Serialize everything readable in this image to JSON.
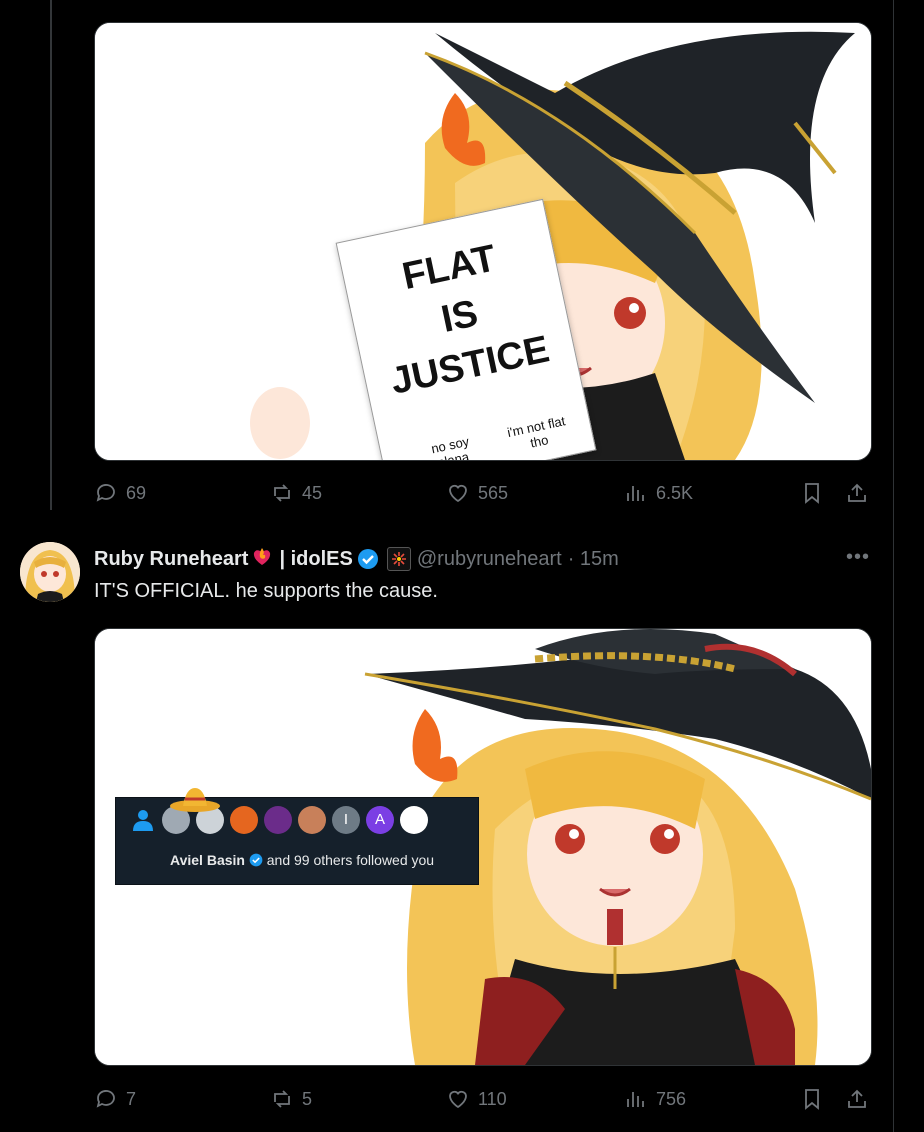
{
  "post1": {
    "sign": {
      "line1": "FLAT",
      "line2": "IS",
      "line3": "JUSTICE",
      "note_left": "no soy plana",
      "note_right": "i'm not flat tho"
    },
    "stats": {
      "replies": "69",
      "reposts": "45",
      "likes": "565",
      "views": "6.5K"
    }
  },
  "post2": {
    "author": {
      "name": "Ruby Runeheart",
      "suffix": "| idolES",
      "handle": "@rubyruneheart",
      "time": "· 15m"
    },
    "text": "IT'S OFFICIAL. he supports the cause.",
    "notification": {
      "name": "Aviel Basin",
      "rest": "and 99 others followed you",
      "letters": [
        "I",
        "A"
      ]
    },
    "stats": {
      "replies": "7",
      "reposts": "5",
      "likes": "110",
      "views": "756"
    }
  },
  "more_label": "•••",
  "colors": {
    "background": "#000000",
    "text": "#e7e9ea",
    "muted": "#71767b",
    "verified": "#1d9bf0"
  }
}
